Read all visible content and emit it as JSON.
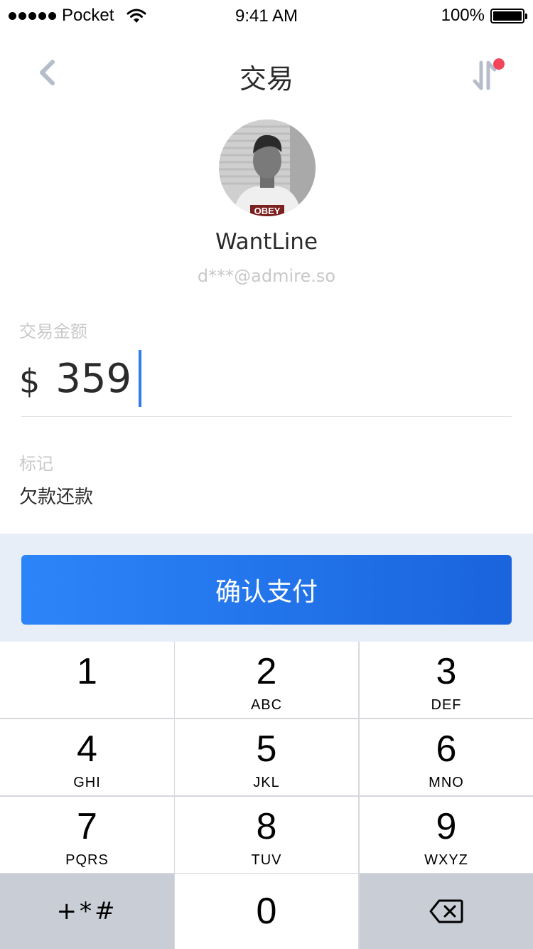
{
  "status_bar": {
    "carrier": "Pocket",
    "time": "9:41 AM",
    "battery": "100%"
  },
  "nav": {
    "title": "交易"
  },
  "profile": {
    "name": "WantLine",
    "email": "d***@admire.so",
    "avatar_shirt_text": "OBEY"
  },
  "form": {
    "amount_label": "交易金额",
    "currency": "$",
    "amount": "359",
    "memo_label": "标记",
    "memo_value": "欠款还款"
  },
  "confirm_label": "确认支付",
  "keypad": {
    "keys": [
      {
        "num": "1",
        "letters": ""
      },
      {
        "num": "2",
        "letters": "ABC"
      },
      {
        "num": "3",
        "letters": "DEF"
      },
      {
        "num": "4",
        "letters": "GHI"
      },
      {
        "num": "5",
        "letters": "JKL"
      },
      {
        "num": "6",
        "letters": "MNO"
      },
      {
        "num": "7",
        "letters": "PQRS"
      },
      {
        "num": "8",
        "letters": "TUV"
      },
      {
        "num": "9",
        "letters": "WXYZ"
      }
    ],
    "symbols": "+*#",
    "zero": "0"
  },
  "colors": {
    "accent": "#2f7bf0",
    "badge": "#f2455c",
    "confirm_area_bg": "#e8eef7"
  }
}
